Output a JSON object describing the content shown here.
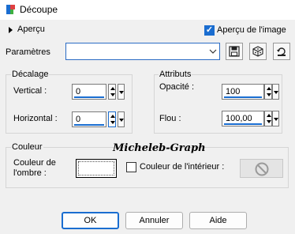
{
  "window": {
    "title": "Découpe"
  },
  "preview": {
    "toggle_label": "Aperçu",
    "image_preview_label": "Aperçu de l'image",
    "image_preview_checked": true
  },
  "params": {
    "label": "Paramètres",
    "value": ""
  },
  "toolbar": {
    "icons": [
      "save-preset-icon",
      "randomize-dice-icon",
      "reset-icon"
    ]
  },
  "offset": {
    "group_label": "Décalage",
    "vertical_label": "Vertical :",
    "vertical_value": "0",
    "horizontal_label": "Horizontal :",
    "horizontal_value": "0"
  },
  "attributes": {
    "group_label": "Attributs",
    "opacity_label": "Opacité :",
    "opacity_value": "100",
    "blur_label": "Flou :",
    "blur_value": "100,00"
  },
  "color": {
    "group_label": "Couleur",
    "shadow_label_line1": "Couleur de",
    "shadow_label_line2": "l'ombre :",
    "shadow_color": "#ffffff",
    "interior_label": "Couleur de l'intérieur :",
    "interior_checked": false
  },
  "watermark": "Micheleb-Graph",
  "buttons": {
    "ok": "OK",
    "cancel": "Annuler",
    "help": "Aide"
  },
  "colors": {
    "accent": "#1a6dd0"
  }
}
